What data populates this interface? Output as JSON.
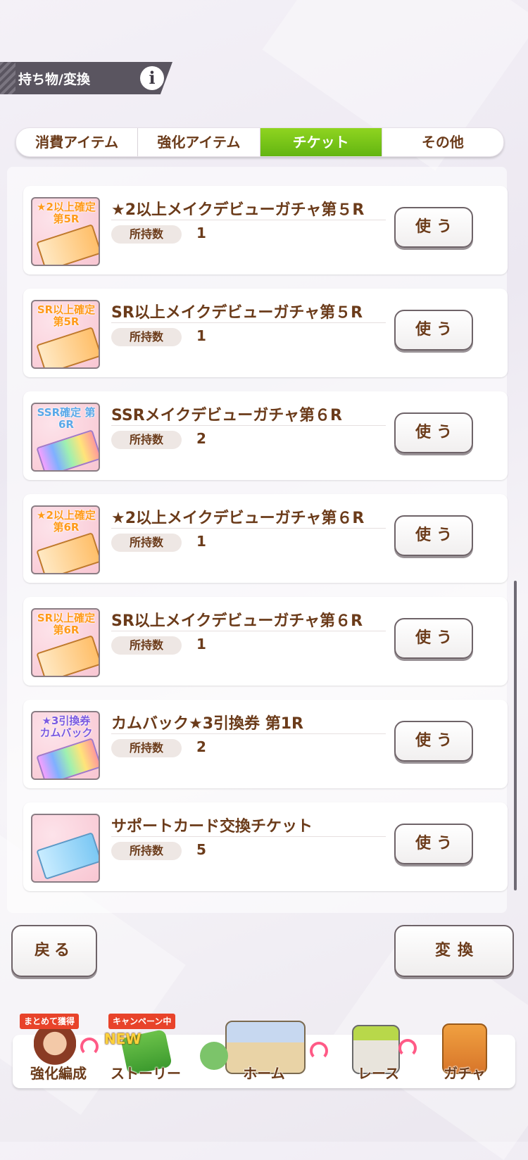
{
  "header": {
    "title": "持ち物/変換",
    "info_icon": "i"
  },
  "tabs": [
    {
      "label": "消費アイテム",
      "active": false
    },
    {
      "label": "強化アイテム",
      "active": false
    },
    {
      "label": "チケット",
      "active": true
    },
    {
      "label": "その他",
      "active": false
    }
  ],
  "items": [
    {
      "icon_text": "★2以上確定 第5R",
      "name": "★2以上メイクデビューガチャ第５R",
      "own_label": "所持数",
      "count": "1",
      "use_label": "使う"
    },
    {
      "icon_text": "SR以上確定 第5R",
      "name": "SR以上メイクデビューガチャ第５R",
      "own_label": "所持数",
      "count": "1",
      "use_label": "使う"
    },
    {
      "icon_text": "SSR確定 第6R",
      "name": "SSRメイクデビューガチャ第６R",
      "own_label": "所持数",
      "count": "2",
      "use_label": "使う"
    },
    {
      "icon_text": "★2以上確定 第6R",
      "name": "★2以上メイクデビューガチャ第６R",
      "own_label": "所持数",
      "count": "1",
      "use_label": "使う"
    },
    {
      "icon_text": "SR以上確定 第6R",
      "name": "SR以上メイクデビューガチャ第６R",
      "own_label": "所持数",
      "count": "1",
      "use_label": "使う"
    },
    {
      "icon_text": "★3引換券 カムバック",
      "name": "カムバック★3引換券 第1R",
      "own_label": "所持数",
      "count": "2",
      "use_label": "使う"
    },
    {
      "icon_text": "",
      "name": "サポートカード交換チケット",
      "own_label": "所持数",
      "count": "5",
      "use_label": "使う"
    }
  ],
  "buttons": {
    "back": "戻る",
    "exchange": "変換"
  },
  "nav": [
    {
      "label": "強化編成",
      "tag": "まとめて獲得"
    },
    {
      "label": "ストーリー",
      "tag": "キャンペーン中",
      "badge": "NEW"
    },
    {
      "label": "ホーム"
    },
    {
      "label": "レース"
    },
    {
      "label": "ガチャ"
    }
  ],
  "colors": {
    "accent_tab": "#7cc51a",
    "text_brown": "#6b3b1a",
    "tag_red": "#e8432a"
  }
}
